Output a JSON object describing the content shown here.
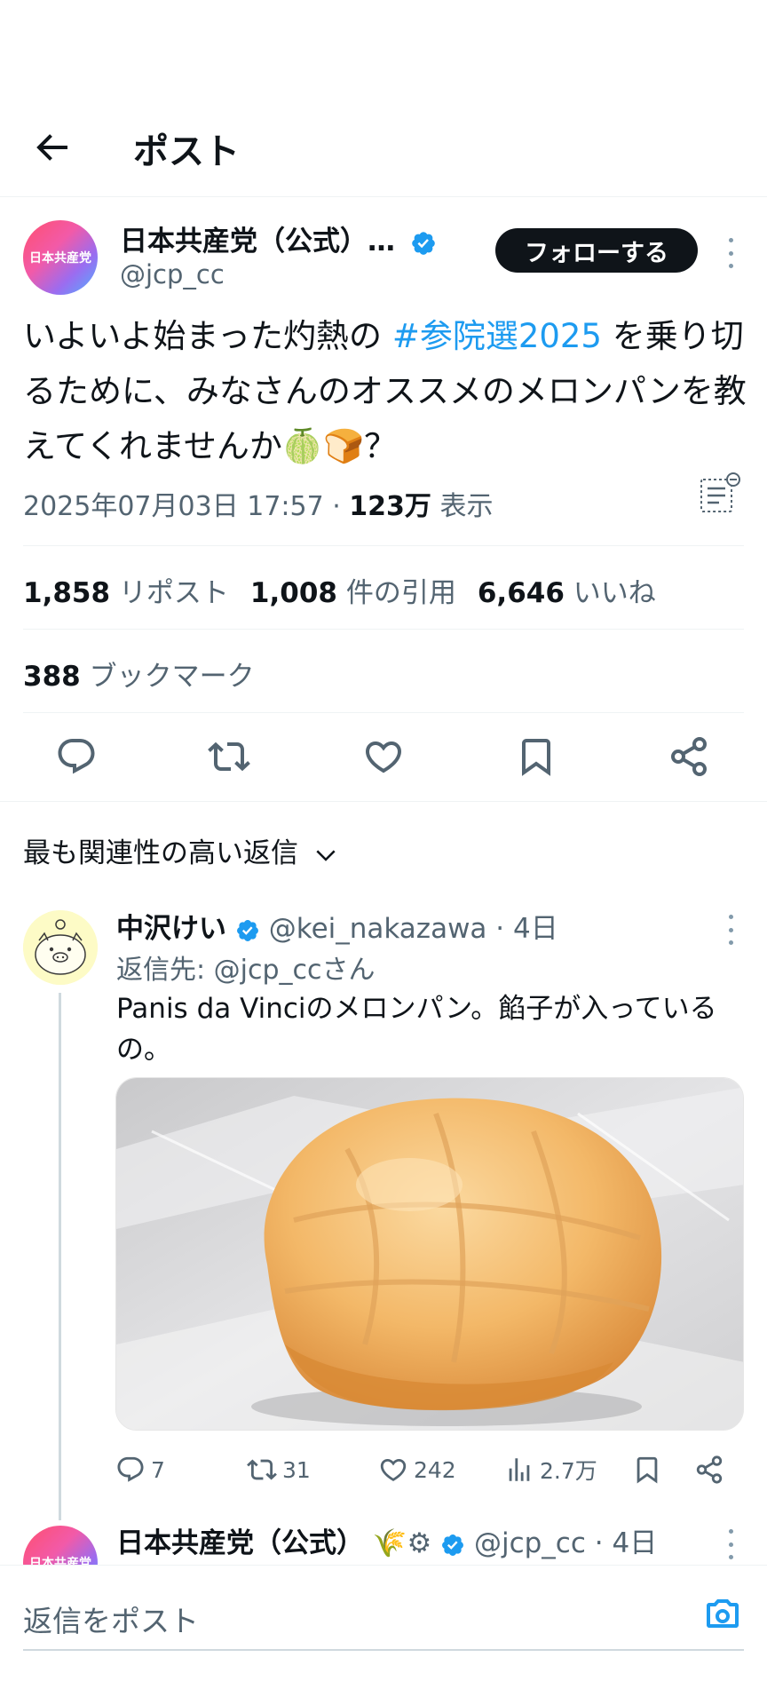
{
  "header": {
    "title": "ポスト"
  },
  "post": {
    "avatar_text": "日本共産党",
    "author_name": "日本共産党（公式）…",
    "author_handle": "@jcp_cc",
    "follow_label": "フォローする",
    "text_before": "いよいよ始まった灼熱の ",
    "hashtag": "#参院選2025",
    "text_after": " を乗り切るために、みなさんのオススメのメロンパンを教えてくれませんか🍈🍞？",
    "timestamp": "2025年07月03日 17:57 · ",
    "views_count": "123万",
    "views_label": " 表示"
  },
  "stats": {
    "reposts_count": "1,858",
    "reposts_label": "リポスト",
    "quotes_count": "1,008",
    "quotes_label": "件の引用",
    "likes_count": "6,646",
    "likes_label": "いいね",
    "bookmarks_count": "388",
    "bookmarks_label": "ブックマーク"
  },
  "sort": {
    "label": "最も関連性の高い返信"
  },
  "reply1": {
    "name": "中沢けい",
    "handle": "@kei_nakazawa",
    "time": "· 4日",
    "reply_to_prefix": "返信先: ",
    "reply_to_handle": "@jcp_cc",
    "reply_to_suffix": "さん",
    "text": "Panis da Vinciのメロンパン。餡子が入っているの。",
    "replies": "7",
    "reposts": "31",
    "likes": "242",
    "views": "2.7万"
  },
  "reply2": {
    "avatar_text": "日本共産党",
    "name": "日本共産党（公式）",
    "emoji": "🌾⚙",
    "handle": "@jcp_cc",
    "time": "· 4日"
  },
  "composer": {
    "placeholder": "返信をポスト"
  },
  "colors": {
    "accent": "#1d9bf0",
    "text": "#0f1419",
    "secondary": "#536471",
    "border": "#eff3f4"
  },
  "icons": [
    "back-arrow-icon",
    "verified-badge-icon",
    "more-vertical-icon",
    "translate-icon",
    "reply-icon",
    "repost-icon",
    "like-icon",
    "bookmark-icon",
    "share-icon",
    "views-icon",
    "chevron-down-icon",
    "camera-icon"
  ]
}
